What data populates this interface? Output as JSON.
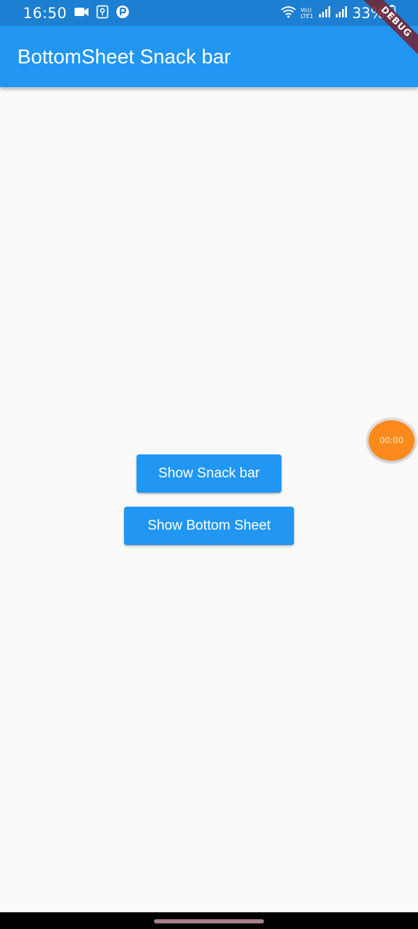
{
  "status_bar": {
    "time": "16:50",
    "battery": "33%",
    "network_label": "Vo)) LTE1",
    "icons": [
      "video-camera-icon",
      "sim-card-icon",
      "app-notification-icon",
      "wifi-icon",
      "signal-icon",
      "signal-icon-2",
      "battery-icon"
    ]
  },
  "app_bar": {
    "title": "BottomSheet Snack bar"
  },
  "debug_banner": {
    "label": "DEBUG"
  },
  "main": {
    "show_snackbar_label": "Show Snack bar",
    "show_bottom_sheet_label": "Show Bottom Sheet"
  },
  "floating_timer": {
    "time": "00:00"
  },
  "colors": {
    "primary": "#2196f3",
    "status_bar": "#1c7fd1",
    "background": "#fafafa",
    "timer_orange": "#ff8a1c"
  }
}
